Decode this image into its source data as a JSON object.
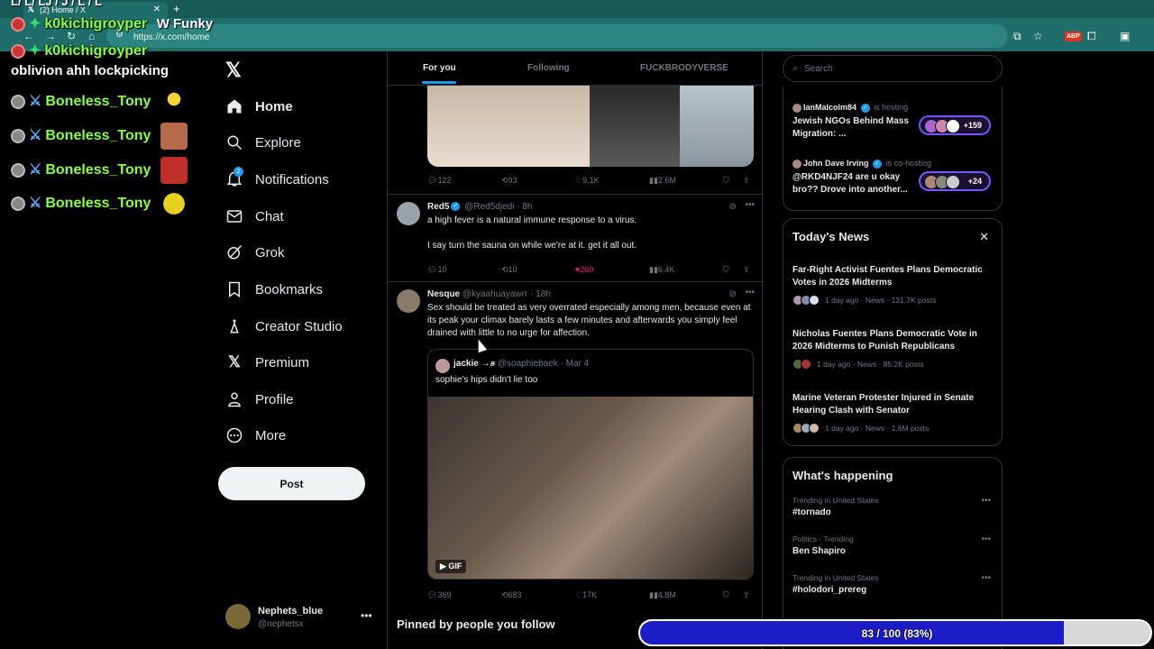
{
  "browser": {
    "tab_title": "(2) Home / X",
    "tab_count_badge": "2",
    "url": "https://x.com/home",
    "ext_badge": "ABP"
  },
  "overlay": {
    "top_partial": "L/ L/ LJ / J / L / L",
    "lines": [
      {
        "user": "k0kichigroyper",
        "msg": "W Funky"
      },
      {
        "user": "k0kichigroyper",
        "msg": ""
      },
      {
        "user": "",
        "msg": "oblivion ahh lockpicking"
      },
      {
        "user": "Boneless_Tony",
        "msg": ""
      },
      {
        "user": "Boneless_Tony",
        "msg": ""
      },
      {
        "user": "Boneless_Tony",
        "msg": ""
      },
      {
        "user": "Boneless_Tony",
        "msg": ""
      }
    ]
  },
  "sidebar": {
    "items": [
      {
        "label": "Home",
        "icon": "home-icon"
      },
      {
        "label": "Explore",
        "icon": "search-icon"
      },
      {
        "label": "Notifications",
        "icon": "bell-icon",
        "badge": "2"
      },
      {
        "label": "Chat",
        "icon": "mail-icon"
      },
      {
        "label": "Grok",
        "icon": "grok-icon"
      },
      {
        "label": "Bookmarks",
        "icon": "bookmark-icon"
      },
      {
        "label": "Creator Studio",
        "icon": "creator-icon"
      },
      {
        "label": "Premium",
        "icon": "x-icon"
      },
      {
        "label": "Profile",
        "icon": "person-icon"
      },
      {
        "label": "More",
        "icon": "more-circle-icon"
      }
    ],
    "post_label": "Post",
    "account": {
      "name": "Nephets_blue",
      "handle": "@nephetsx"
    }
  },
  "timeline": {
    "tabs": [
      "For you",
      "Following",
      "FUCKBRODYVERSE"
    ],
    "first_actions": {
      "replies": "122",
      "reposts": "93",
      "likes": "9.1K",
      "views": "2.6M"
    },
    "posts": [
      {
        "name": "Red5",
        "handle": "@Red5djedi",
        "time": "8h",
        "text1": "a high fever is a natural immune response to a virus.",
        "text2": "I say turn the sauna on while we're at it. get it all out.",
        "actions": {
          "replies": "10",
          "reposts": "10",
          "likes": "260",
          "views": "6.4K"
        }
      },
      {
        "name": "Nesque",
        "handle": "@kyaahuayawrr",
        "time": "18h",
        "text": "Sex should be treated as very overrated especially among men, because even at its peak your climax barely lasts a few minutes and afterwards you simply feel drained with little to no urge for affection.",
        "quote": {
          "name": "jackie →ச",
          "handle": "@soaphiebaek",
          "date": "Mar 4",
          "text": "sophie's hips didn't lie too",
          "gif_label": "GIF"
        },
        "actions": {
          "replies": "369",
          "reposts": "683",
          "likes": "17K",
          "views": "4.8M"
        }
      }
    ],
    "pinned_heading": "Pinned by people you follow"
  },
  "right": {
    "search_placeholder": "Search",
    "spaces": [
      {
        "host": "IanMalcolm84",
        "role": "is hosting",
        "title": "Jewish NGOs Behind Mass Migration: ...",
        "count": "+159"
      },
      {
        "host": "John Dave Irving",
        "role": "is co-hosting",
        "title": "@RKD4NJF24 are u okay bro?? Drove into another...",
        "count": "+24"
      }
    ],
    "news_heading": "Today's News",
    "news": [
      {
        "title": "Far-Right Activist Fuentes Plans Democratic Votes in 2026 Midterms",
        "meta": "1 day ago · News · 131.7K posts"
      },
      {
        "title": "Nicholas Fuentes Plans Democratic Vote in 2026 Midterms to Punish Republicans",
        "meta": "1 day ago · News · 85.2K posts"
      },
      {
        "title": "Marine Veteran Protester Injured in Senate Hearing Clash with Senator",
        "meta": "1 day ago · News · 1.6M posts"
      }
    ],
    "happening_heading": "What's happening",
    "trends": [
      {
        "context": "Trending in United States",
        "title": "#tornado"
      },
      {
        "context": "Politics · Trending",
        "title": "Ben Shapiro"
      },
      {
        "context": "Trending in United States",
        "title": "#holodori_prereg"
      }
    ]
  },
  "progress": {
    "label": "83 / 100 (83%)",
    "fraction": 0.83
  },
  "colors": {
    "accent": "#1d9bf0",
    "like": "#f91880",
    "progress": "#1c1cc8",
    "chat_name": "#8bff3c"
  }
}
